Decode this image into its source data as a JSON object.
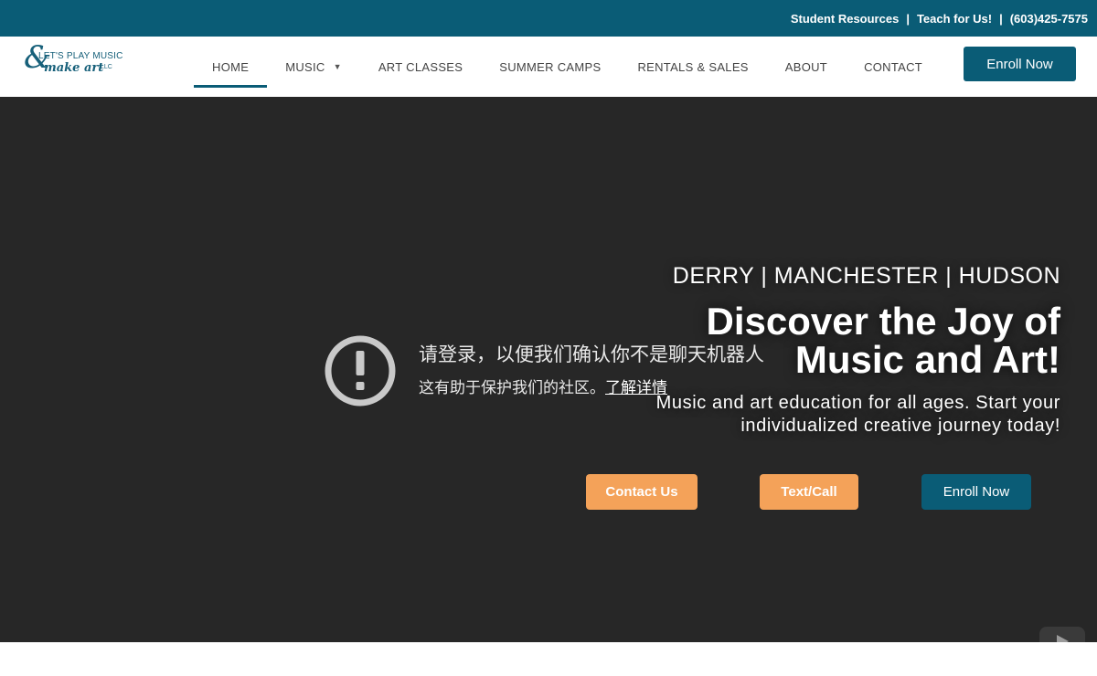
{
  "topbar": {
    "links": [
      "Student Resources",
      "Teach for Us!",
      "(603)425-7575"
    ],
    "separator": "|"
  },
  "logo": {
    "ampersand": "&",
    "line1": "LET'S PLAY MUSIC",
    "line2": "make art",
    "suffix": "LLC"
  },
  "nav": {
    "items": [
      {
        "label": "HOME",
        "active": true
      },
      {
        "label": "MUSIC",
        "has_dropdown": true
      },
      {
        "label": "ART CLASSES"
      },
      {
        "label": "SUMMER CAMPS"
      },
      {
        "label": "RENTALS & SALES"
      },
      {
        "label": "ABOUT"
      },
      {
        "label": "CONTACT"
      }
    ],
    "enroll_label": "Enroll Now"
  },
  "notice": {
    "icon": "exclamation-circle-icon",
    "title": "请登录，以便我们确认你不是聊天机器人",
    "sub": "这有助于保护我们的社区。",
    "link": "了解详情"
  },
  "hero": {
    "locations": "DERRY | MANCHESTER | HUDSON",
    "headline_line1": "Discover the Joy of",
    "headline_line2": "Music and Art!",
    "tagline_line1": "Music and art education for all ages. Start your",
    "tagline_line2": "individualized creative journey today!",
    "buttons": {
      "contact": "Contact Us",
      "textcall": "Text/Call",
      "enroll": "Enroll Now"
    }
  },
  "colors": {
    "brand_teal": "#0a5c76",
    "accent_orange": "#f4a259",
    "hero_bg": "#272727"
  },
  "video_player_icon": "youtube-play-icon"
}
